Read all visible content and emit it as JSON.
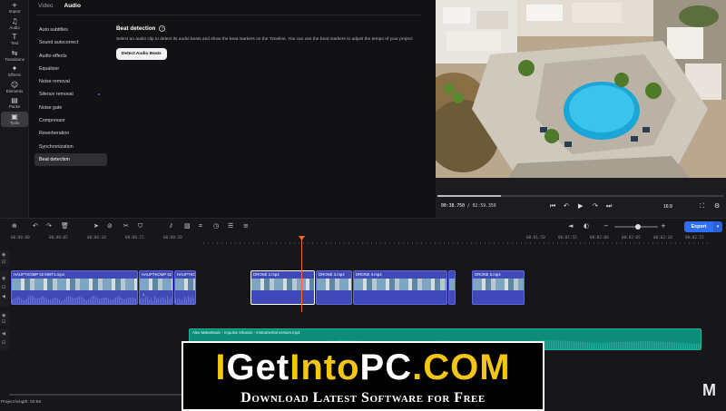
{
  "sidebar": {
    "items": [
      {
        "icon": "+",
        "label": "Import"
      },
      {
        "icon": "♫",
        "label": "Audio"
      },
      {
        "icon": "T",
        "label": "Text"
      },
      {
        "icon": "⇆",
        "label": "Transitions"
      },
      {
        "icon": "✦",
        "label": "Effects"
      },
      {
        "icon": "☺",
        "label": "Elements"
      },
      {
        "icon": "▤",
        "label": "Packs"
      },
      {
        "icon": "▣",
        "label": "Tools"
      }
    ]
  },
  "panel": {
    "tabs": {
      "video": "Video",
      "audio": "Audio"
    },
    "menu": [
      "Auto subtitles",
      "Sound autocorrect",
      "Audio effects",
      "Equalizer",
      "Noise removal",
      "Silence removal",
      "Noise gate",
      "Compressor",
      "Reverberation",
      "Synchronization",
      "Beat detection"
    ],
    "detail": {
      "title": "Beat detection",
      "help": "?",
      "description": "Select an audio clip to detect its audio beats and show the beat markers on the Timeline. You can use the beat markers to adjust the tempo of your project",
      "button": "Detect Audio Beats"
    }
  },
  "player": {
    "current_time": "00:38.750",
    "total_time": "02:59.350",
    "progress": 0.22,
    "aspect_ratio": "16:9",
    "controls": {
      "prev": "⏮",
      "undo": "↶",
      "play": "▶",
      "redo": "↷",
      "next": "⏭",
      "fullscreen": "⛶",
      "settings": "⚙"
    }
  },
  "timeline": {
    "export_label": "Export",
    "export_dropdown": "▾",
    "ruler_ticks": [
      "00:00:00",
      "00:00:05",
      "00:00:10",
      "00:00:15",
      "00:00:20"
    ],
    "ruler_ticks_right": [
      "00:01:50",
      "00:01:55",
      "00:02:00",
      "00:02:05",
      "00:02:10",
      "00:02:15"
    ],
    "video_clips": [
      {
        "name": "HAUPTKOMP 52 MMT1.mp4"
      },
      {
        "name": "HAUPTKOMP 52"
      },
      {
        "name": "HAUPTKO"
      },
      {
        "name": "DRONE 2.mp4"
      },
      {
        "name": "DRONE 3.mp4"
      },
      {
        "name": "DRONE 4.mp4"
      },
      {
        "name": ""
      },
      {
        "name": "DRONE 5.mp4"
      }
    ],
    "clip_badge": "1",
    "audio_clip": {
      "name": "Alex MakeMusic - Impulse Infusion - Instrumental version.mp3"
    },
    "project_length": "Project length: 02:59"
  },
  "watermark": {
    "logo_part1": "I",
    "logo_part2": "Get",
    "logo_part3": "Into",
    "logo_part4": "PC",
    "logo_part5": ".COM",
    "tagline": "Download Latest Software for Free",
    "corner": "M"
  },
  "colors": {
    "accent": "#2f6ff0",
    "playhead": "#ff6a2a",
    "video_clip": "#3f49b8",
    "audio_clip": "#0d8c7a",
    "watermark_yellow": "#f3c614"
  }
}
